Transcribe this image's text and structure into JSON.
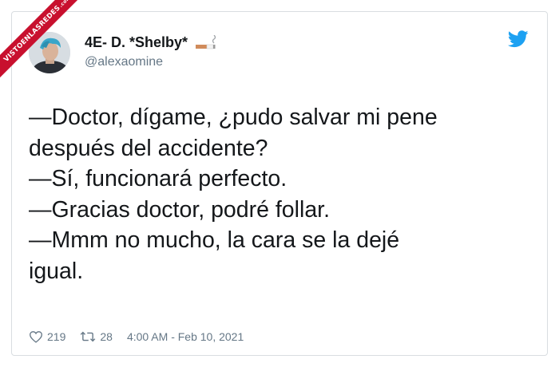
{
  "watermark": {
    "text": "VISTOENLASREDES",
    "suffix": ".com"
  },
  "author": {
    "display_name": "4E- D. *Shelby*",
    "name_icon": "cigarette-smoke-icon",
    "handle": "@alexaomine"
  },
  "brand_icon": "twitter-bird-icon",
  "tweet": {
    "lines": [
      "—Doctor, dígame, ¿pudo salvar mi pene",
      "después del accidente?",
      "—Sí, funcionará perfecto.",
      "—Gracias doctor, podré follar.",
      "—Mmm no mucho, la cara se la dejé",
      "igual."
    ]
  },
  "stats": {
    "likes": "219",
    "retweets": "28",
    "timestamp": "4:00 AM - Feb 10, 2021"
  },
  "colors": {
    "brand": "#1da1f2",
    "ribbon": "#c8102e",
    "text": "#14171a",
    "muted": "#657786"
  }
}
